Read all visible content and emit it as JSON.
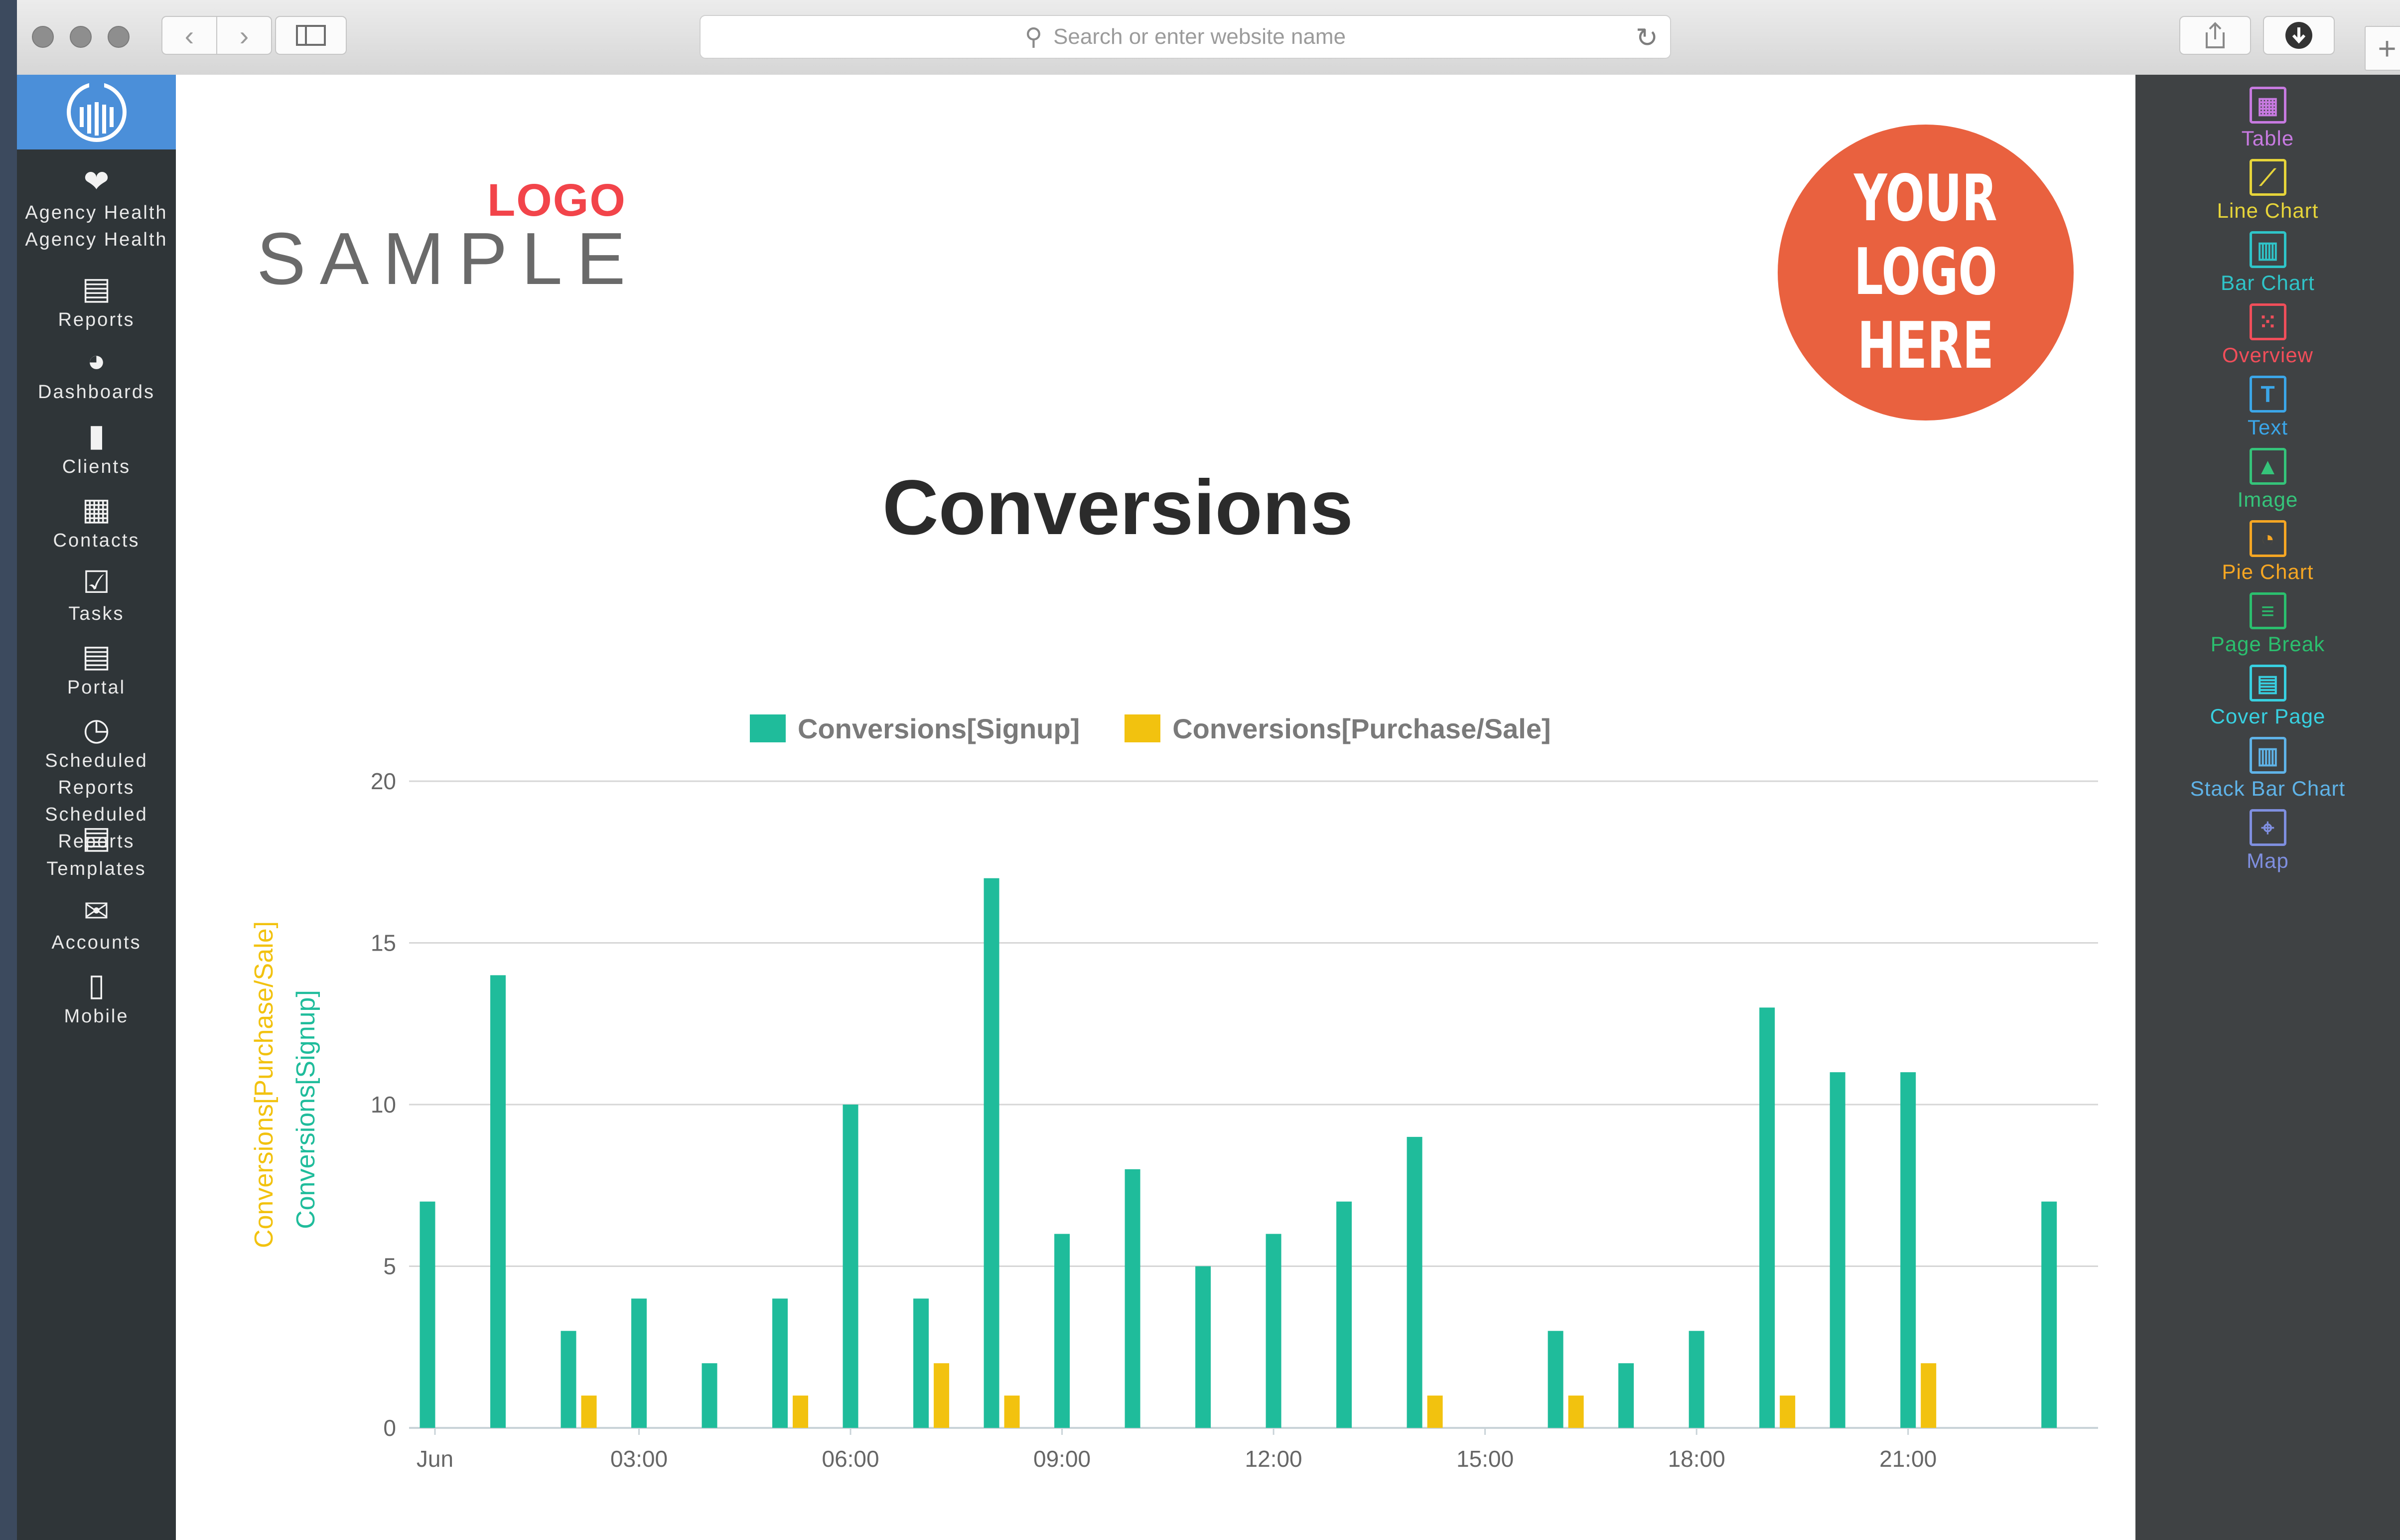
{
  "browser": {
    "address_placeholder": "Search or enter website name"
  },
  "sidebar": {
    "items": [
      {
        "label": "Agency\nHealth",
        "icon": "heart-icon"
      },
      {
        "label": "Reports",
        "icon": "report-icon"
      },
      {
        "label": "Dashboards",
        "icon": "pie-icon"
      },
      {
        "label": "Clients",
        "icon": "briefcase-icon"
      },
      {
        "label": "Contacts",
        "icon": "address-book-icon"
      },
      {
        "label": "Tasks",
        "icon": "checkbox-icon"
      },
      {
        "label": "Portal",
        "icon": "portal-icon"
      },
      {
        "label": "Scheduled\nReports",
        "icon": "clock-icon"
      },
      {
        "label": "Templates",
        "icon": "template-icon"
      },
      {
        "label": "Accounts",
        "icon": "accounts-icon"
      },
      {
        "label": "Mobile",
        "icon": "mobile-icon"
      }
    ]
  },
  "palette": {
    "items": [
      {
        "label": "Table",
        "color": "#c77ae0",
        "icon": "table-icon"
      },
      {
        "label": "Line Chart",
        "color": "#e6d43a",
        "icon": "line-chart-icon"
      },
      {
        "label": "Bar Chart",
        "color": "#2fc4c8",
        "icon": "bar-chart-icon"
      },
      {
        "label": "Overview",
        "color": "#f04e5a",
        "icon": "overview-icon"
      },
      {
        "label": "Text",
        "color": "#3ba6e8",
        "icon": "text-icon"
      },
      {
        "label": "Image",
        "color": "#35c47a",
        "icon": "image-icon"
      },
      {
        "label": "Pie Chart",
        "color": "#f6a623",
        "icon": "pie-chart-icon"
      },
      {
        "label": "Page Break",
        "color": "#2bbf6e",
        "icon": "page-break-icon"
      },
      {
        "label": "Cover Page",
        "color": "#38d0e0",
        "icon": "cover-page-icon"
      },
      {
        "label": "Stack Bar Chart",
        "color": "#5fb3e8",
        "icon": "stack-bar-chart-icon"
      },
      {
        "label": "Map",
        "color": "#7f8fe0",
        "icon": "map-icon"
      }
    ]
  },
  "report": {
    "logo_top": "LOGO",
    "logo_bottom": "SAMPLE",
    "logo_circle": "YOUR\nLOGO\nHERE",
    "title": "Conversions"
  },
  "chart_data": {
    "type": "bar",
    "categories": [
      "Jun",
      "01:00",
      "02:00",
      "03:00",
      "04:00",
      "05:00",
      "06:00",
      "07:00",
      "08:00",
      "09:00",
      "10:00",
      "11:00",
      "12:00",
      "13:00",
      "14:00",
      "15:00",
      "16:00",
      "17:00",
      "18:00",
      "19:00",
      "20:00",
      "21:00",
      "22:00",
      "23:00"
    ],
    "tick_labels": [
      "Jun",
      "03:00",
      "06:00",
      "09:00",
      "12:00",
      "15:00",
      "18:00",
      "21:00"
    ],
    "series": [
      {
        "name": "Conversions[Signup]",
        "color": "#1fbc9b",
        "values": [
          7,
          14,
          3,
          4,
          2,
          4,
          10,
          4,
          17,
          6,
          8,
          5,
          6,
          7,
          9,
          0,
          3,
          2,
          3,
          13,
          11,
          11,
          0,
          7
        ]
      },
      {
        "name": "Conversions[Purchase/Sale]",
        "color": "#f2c20f",
        "values": [
          0,
          0,
          1,
          0,
          0,
          1,
          0,
          2,
          1,
          0,
          0,
          0,
          0,
          0,
          1,
          0,
          1,
          0,
          0,
          1,
          0,
          2,
          0,
          0
        ]
      }
    ],
    "ylabel": "Conversions[Signup]",
    "ylabel2": "Conversions[Purchase/Sale]",
    "ylim": [
      0,
      20
    ],
    "yticks": [
      0,
      5,
      10,
      15,
      20
    ],
    "grid": true,
    "legend": "top-center"
  }
}
